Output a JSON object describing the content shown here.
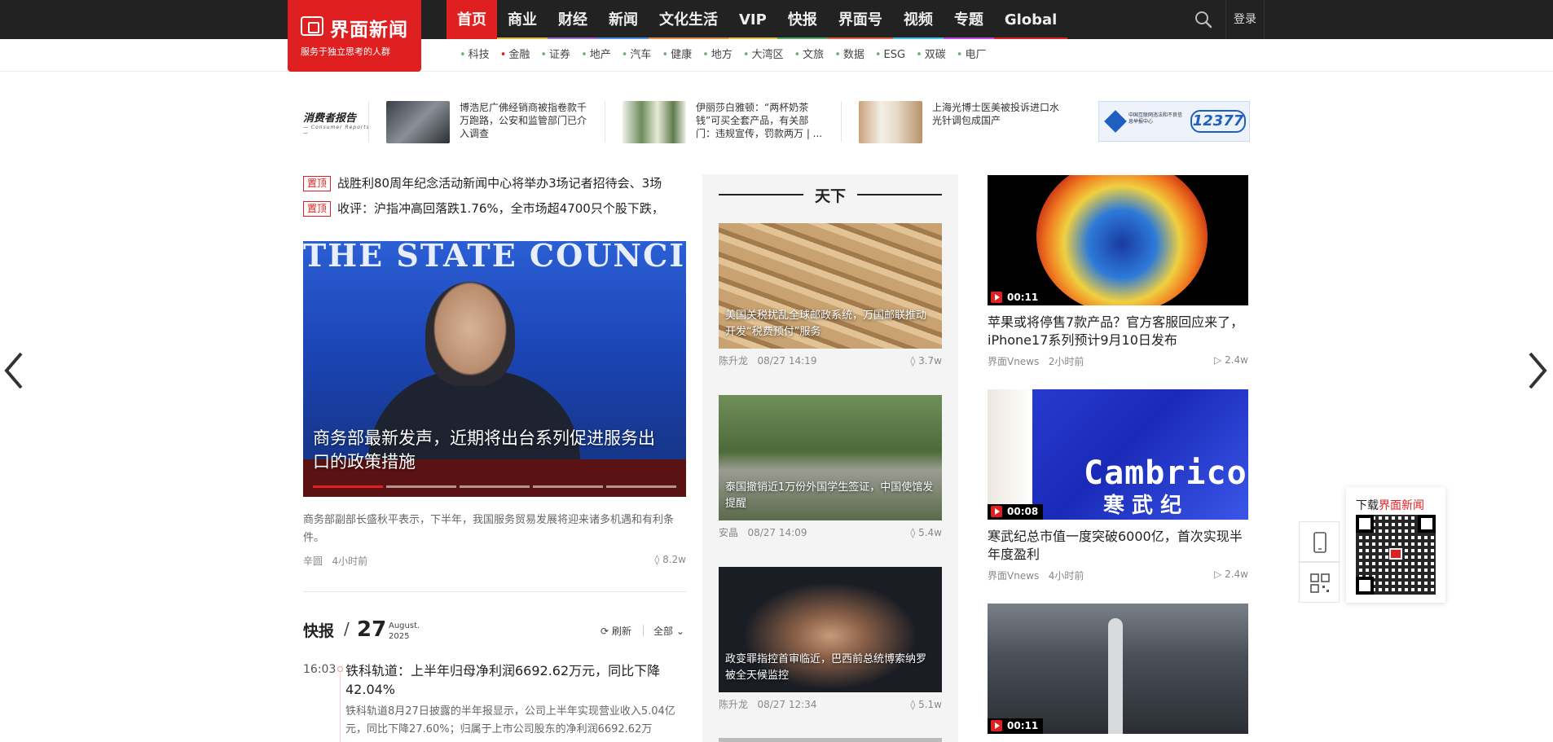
{
  "brand": {
    "name": "界面新闻",
    "slogan": "服务于独立思考的人群"
  },
  "nav": [
    "首页",
    "商业",
    "财经",
    "新闻",
    "文化生活",
    "VIP",
    "快报",
    "界面号",
    "视频",
    "专题",
    "Global"
  ],
  "login": "登录",
  "subnav": [
    "科技",
    "金融",
    "证券",
    "地产",
    "汽车",
    "健康",
    "地方",
    "大湾区",
    "文旅",
    "数据",
    "ESG",
    "双碳",
    "电厂"
  ],
  "consumer_report": {
    "logo": "消费者报告",
    "logo_sub": "— Consumer Reports —",
    "items": [
      {
        "text": "博浩尼广佛经销商被指卷款千万跑路，公安和监管部门已介入调查"
      },
      {
        "text": "伊丽莎白雅顿：“两杯奶茶钱”可买全套产品，有关部门：违规宣传，罚款两万 | ..."
      },
      {
        "text": "上海光博士医美被投诉进口水光针调包成国产"
      }
    ],
    "ad": {
      "text": "中国互联网违法和不良信息举报中心",
      "number": "12377"
    }
  },
  "pinned": [
    {
      "tag": "置顶",
      "text": "战胜利80周年纪念活动新闻中心将举办3场记者招待会、3场"
    },
    {
      "tag": "置顶",
      "text": "收评：沪指冲高回落跌1.76%，全市场超4700只个股下跌，"
    }
  ],
  "hero": {
    "bg_text": "THE STATE COUNCIL IN",
    "caption": "商务部最新发声，近期将出台系列促进服务出口的政策措施",
    "desc": "商务部副部长盛秋平表示，下半年，我国服务贸易发展将迎来诸多机遇和有利条件。",
    "author": "辛圆",
    "time": "4小时前",
    "views": "8.2w"
  },
  "kuaibao": {
    "title": "快报",
    "slash": "/",
    "day": "27",
    "month": "August.",
    "year": "2025",
    "refresh": "刷新",
    "filter": "全部",
    "item": {
      "time": "16:03",
      "headline": "铁科轨道：上半年归母净利润6692.62万元，同比下降42.04%",
      "body": "铁科轨道8月27日披露的半年报显示，公司上半年实现营业收入5.04亿元，同比下降27.60%；归属于上市公司股东的净利润6692.62万"
    }
  },
  "tianxia": {
    "title": "天下",
    "cards": [
      {
        "caption": "美国关税扰乱全球邮政系统，万国邮联推动开发“税费预付”服务",
        "author": "陈升龙",
        "time": "08/27 14:19",
        "views": "3.7w"
      },
      {
        "caption": "泰国撤销近1万份外国学生签证，中国使馆发提醒",
        "author": "安晶",
        "time": "08/27 14:09",
        "views": "5.4w"
      },
      {
        "caption": "政变罪指控首审临近，巴西前总统博索纳罗被全天候监控",
        "author": "陈升龙",
        "time": "08/27 12:34",
        "views": "5.1w"
      }
    ]
  },
  "videos": [
    {
      "duration": "00:11",
      "title": "苹果或将停售7款产品？官方客服回应来了，iPhone17系列预计9月10日发布",
      "source": "界面Vnews",
      "time": "2小时前",
      "views": "2.4w"
    },
    {
      "duration": "00:08",
      "title": "寒武纪总市值一度突破6000亿，首次实现半年度盈利",
      "source": "界面Vnews",
      "time": "4小时前",
      "views": "2.4w",
      "brand_text": "Cambricon",
      "brand_cn": "寒 武 纪"
    },
    {
      "duration": "00:11",
      "title": "",
      "source": "",
      "time": "",
      "views": ""
    }
  ],
  "download": {
    "prefix": "下载",
    "brand": "界面新闻"
  },
  "colors": {
    "accent": "#e02020",
    "topbar": "#222222"
  }
}
